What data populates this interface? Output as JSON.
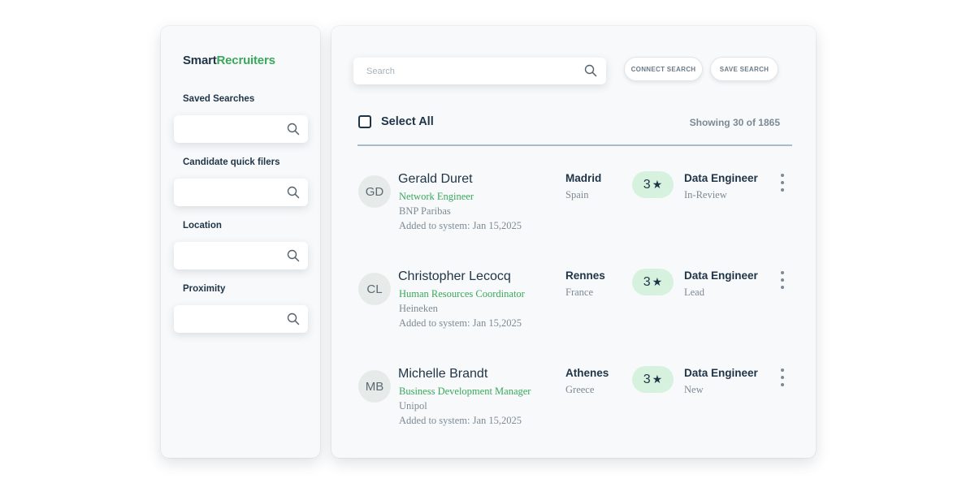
{
  "app": {
    "logo_part1": "Smart",
    "logo_part2": "Recruiters"
  },
  "sidebar": {
    "filters": [
      {
        "label": "Saved Searches"
      },
      {
        "label": "Candidate quick filers"
      },
      {
        "label": "Location"
      },
      {
        "label": "Proximity"
      }
    ]
  },
  "toolbar": {
    "search_placeholder": "Search",
    "connect_search": "CONNECT SEARCH",
    "save_search": "SAVE SEARCH"
  },
  "list": {
    "select_all": "Select All",
    "showing": "Showing 30 of 1865"
  },
  "candidates": [
    {
      "initials": "GD",
      "name": "Gerald Duret",
      "role": "Network Engineer",
      "company": "BNP Paribas",
      "added": "Added to system: Jan 15,2025",
      "city": "Madrid",
      "country": "Spain",
      "rating": "3",
      "job": "Data Engineer",
      "stage": "In-Review"
    },
    {
      "initials": "CL",
      "name": "Christopher Lecocq",
      "role": "Human Resources Coordinator",
      "company": "Heineken",
      "added": "Added to system: Jan 15,2025",
      "city": "Rennes",
      "country": "France",
      "rating": "3",
      "job": "Data Engineer",
      "stage": "Lead"
    },
    {
      "initials": "MB",
      "name": "Michelle Brandt",
      "role": "Business Development Manager",
      "company": "Unipol",
      "added": "Added to system: Jan 15,2025",
      "city": "Athenes",
      "country": "Greece",
      "rating": "3",
      "job": "Data Engineer",
      "stage": "New"
    }
  ],
  "icons": {
    "search": "search-icon",
    "more": "more-vertical-icon",
    "star": "star-icon"
  },
  "colors": {
    "brand_green": "#3aa85c",
    "navy": "#1f3447",
    "rating_bg": "#d6f2df"
  }
}
